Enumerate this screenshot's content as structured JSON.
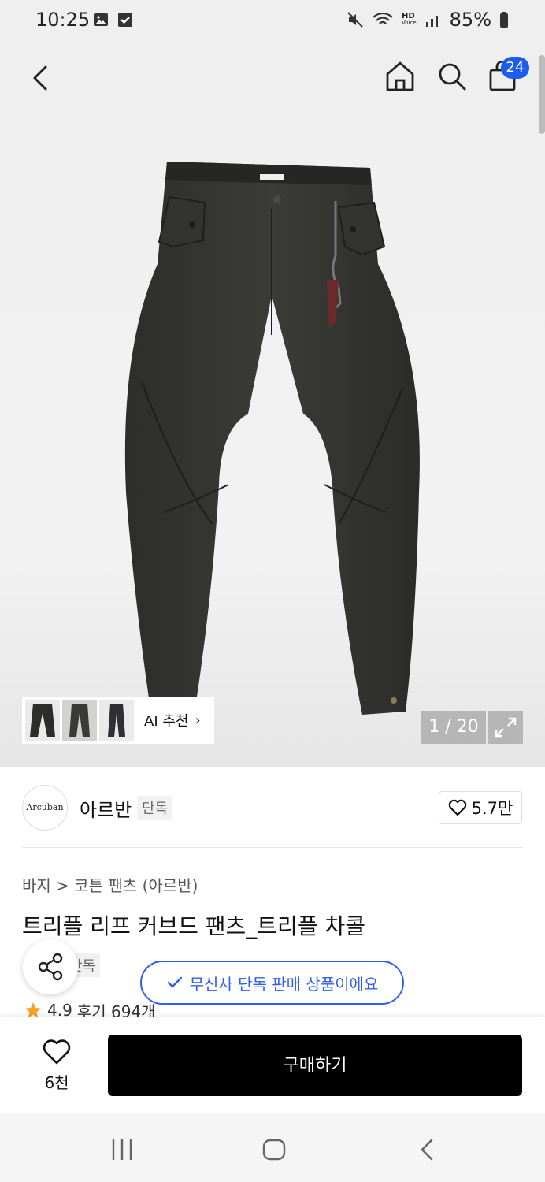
{
  "status_bar": {
    "time": "10:25",
    "battery": "85%",
    "network_label_top": "HD",
    "network_label_bottom": "Voice"
  },
  "header": {
    "back_icon": "chevron-left-icon",
    "home_icon": "home-icon",
    "search_icon": "search-icon",
    "cart_icon": "bag-icon",
    "cart_badge": "24"
  },
  "gallery": {
    "ai_label": "AI 추천",
    "counter": "1 / 20"
  },
  "brand": {
    "logo_text": "Arcuban",
    "name": "아르반",
    "tag": "단독",
    "likes": "5.7만"
  },
  "product": {
    "breadcrumb": "바지 > 코튼 팬츠 (아르반)",
    "title": "트리플 리프 커브드 팬츠_트리플 차콜",
    "tag": "단독",
    "rating": "4.9",
    "reviews": "후기 694개"
  },
  "toast": {
    "text": "무신사 단독 판매 상품이에요"
  },
  "bottom": {
    "wish_count": "6천",
    "buy_label": "구매하기"
  },
  "colors": {
    "accent": "#2f5ff1",
    "badge": "#1e5bf0",
    "star": "#f5a623"
  }
}
